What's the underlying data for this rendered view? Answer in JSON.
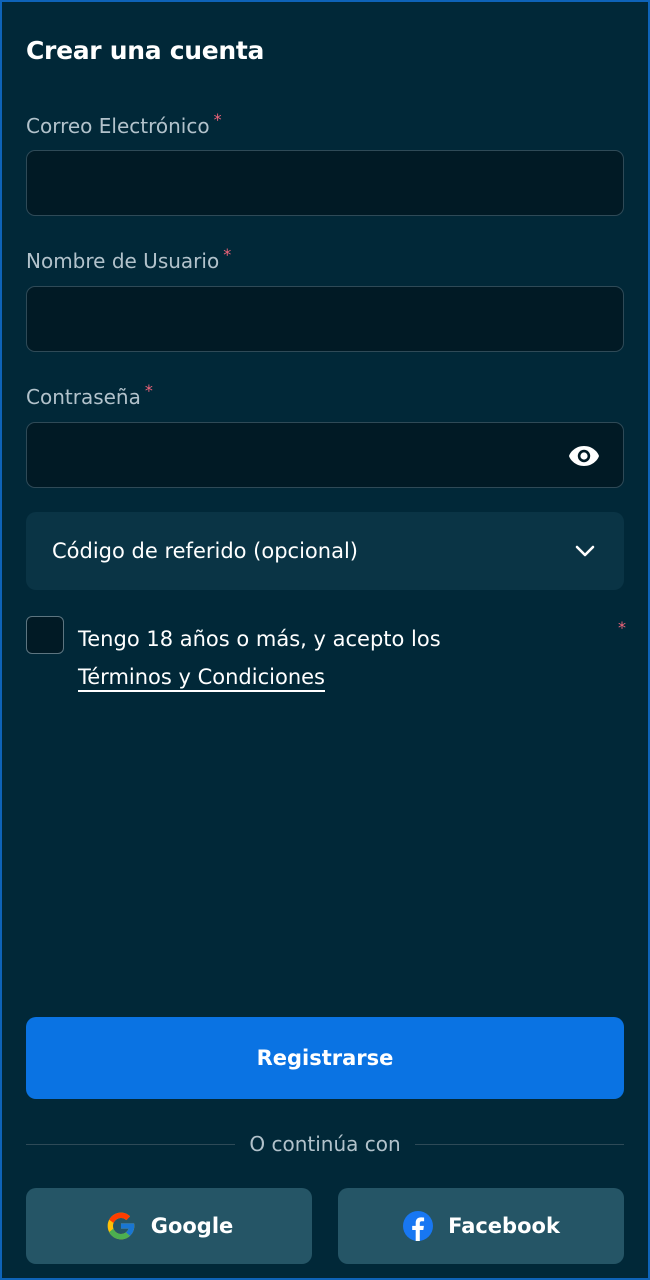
{
  "form": {
    "title": "Crear una cuenta",
    "required_marker": "*",
    "email": {
      "label": "Correo Electrónico",
      "value": "",
      "placeholder": ""
    },
    "username": {
      "label": "Nombre de Usuario",
      "value": "",
      "placeholder": ""
    },
    "password": {
      "label": "Contraseña",
      "value": "",
      "placeholder": "",
      "toggle_icon": "eye-icon"
    },
    "referral": {
      "label": "Código de referido (opcional)",
      "icon": "chevron-down-icon"
    },
    "terms": {
      "text": "Tengo 18 años o más, y acepto los",
      "link": "Términos y Condiciones",
      "checked": false
    },
    "submit_label": "Registrarse"
  },
  "social": {
    "divider_text": "O continúa con",
    "google_label": "Google",
    "facebook_label": "Facebook"
  },
  "colors": {
    "background": "#012838",
    "input_bg": "#011a25",
    "primary_button": "#0a73e3",
    "social_button": "#255566",
    "required": "#f0647a",
    "label": "#b2c2cb"
  }
}
